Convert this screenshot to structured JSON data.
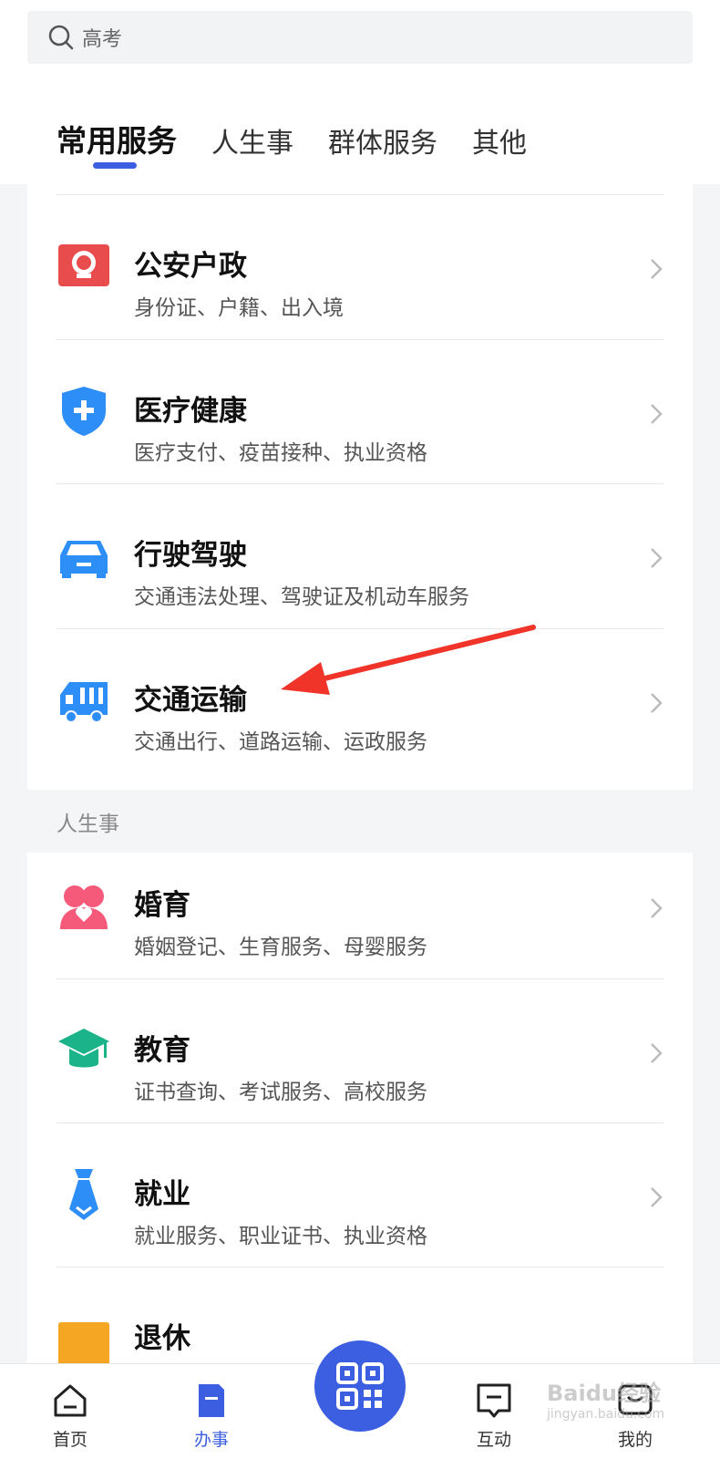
{
  "search": {
    "placeholder": "高考"
  },
  "tabs": [
    {
      "label": "常用服务",
      "active": true
    },
    {
      "label": "人生事"
    },
    {
      "label": "群体服务"
    },
    {
      "label": "其他"
    }
  ],
  "common_services": [
    {
      "title": "公安户政",
      "subtitle": "身份证、户籍、出入境",
      "icon": "police-badge-icon",
      "color": "#e84c4c"
    },
    {
      "title": "医疗健康",
      "subtitle": "医疗支付、疫苗接种、执业资格",
      "icon": "medical-shield-icon",
      "color": "#2e8ef7"
    },
    {
      "title": "行驶驾驶",
      "subtitle": "交通违法处理、驾驶证及机动车服务",
      "icon": "car-icon",
      "color": "#2e8ef7"
    },
    {
      "title": "交通运输",
      "subtitle": "交通出行、道路运输、运政服务",
      "icon": "truck-icon",
      "color": "#2e8ef7"
    }
  ],
  "life_section": {
    "label": "人生事",
    "items": [
      {
        "title": "婚育",
        "subtitle": "婚姻登记、生育服务、母婴服务",
        "icon": "couple-heart-icon",
        "color": "#f55a7a"
      },
      {
        "title": "教育",
        "subtitle": "证书查询、考试服务、高校服务",
        "icon": "graduation-cap-icon",
        "color": "#1bb38a"
      },
      {
        "title": "就业",
        "subtitle": "就业服务、职业证书、执业资格",
        "icon": "necktie-icon",
        "color": "#2e8ef7"
      },
      {
        "title": "退休",
        "subtitle": "",
        "icon": "retire-icon",
        "color": "#f5a623"
      }
    ]
  },
  "bottom_nav": [
    {
      "label": "首页",
      "icon": "home-icon"
    },
    {
      "label": "办事",
      "icon": "document-icon",
      "active": true
    },
    {
      "label": "互动",
      "icon": "chat-icon"
    },
    {
      "label": "我的",
      "icon": "profile-icon"
    }
  ],
  "watermark": {
    "brand": "Baidu经验",
    "url": "jingyan.baidu.com"
  },
  "colors": {
    "accent": "#3b5fe0",
    "annotation_arrow": "#f0342a"
  }
}
